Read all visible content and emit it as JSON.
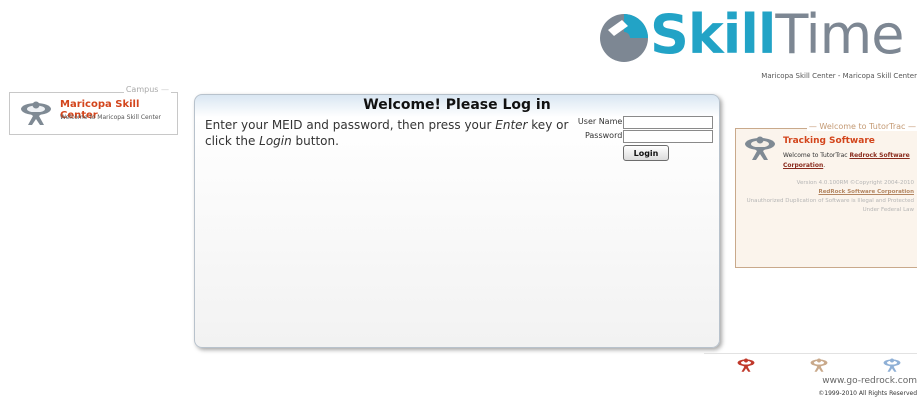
{
  "logo": {
    "part1": "Skill",
    "part2": "Time",
    "subtitle": "Maricopa Skill Center - Maricopa Skill Center"
  },
  "campus": {
    "legend": "Campus",
    "name": "Maricopa Skill Center",
    "welcome": "Welcome to Maricopa Skill Center"
  },
  "login": {
    "heading": "Welcome! Please Log in",
    "instr_part1": "Enter your MEID and password, then press your ",
    "instr_enter": "Enter",
    "instr_part2": " key or click the ",
    "instr_login": "Login",
    "instr_part3": " button.",
    "username_label": "User Name:",
    "username_value": "",
    "password_label": "Password:",
    "password_value": "",
    "button_label": "Login"
  },
  "tutortrac": {
    "legend": "Welcome to TutorTrac",
    "title": "Tracking Software",
    "welcome_prefix": "Welcome to TutorTrac ",
    "welcome_link": "Redrock Software Corporation",
    "welcome_suffix": ".",
    "version": "Version 4.0.100RM ©Copyright 2004-2010",
    "company_link": "RedRock Software Corporation",
    "warning": "Unauthorized Duplication of Software is Illegal and Protected Under Federal Law"
  },
  "footer": {
    "site": "www.go-redrock.com",
    "copyright": "©1999-2010 All Rights Reserved"
  },
  "colors": {
    "brand_teal": "#22a3c6",
    "brand_gray": "#7d8793",
    "accent_orange": "#d3451c",
    "tutor_border": "#c9a98b"
  },
  "icons": {
    "logo_mark": "skilltime-circle-icon",
    "campus_icon": "redrock-figure-icon",
    "tutor_icon": "redrock-figure-icon"
  }
}
